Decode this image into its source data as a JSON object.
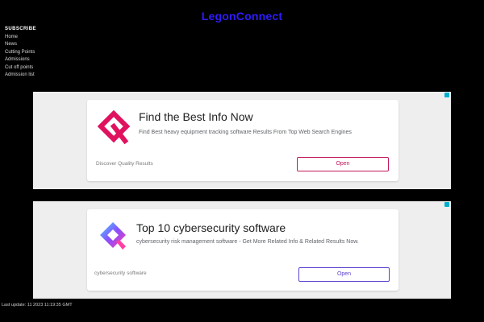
{
  "header": {
    "site_title": "LegonConnect"
  },
  "nav": {
    "items": [
      {
        "label": "SUBSCRIBE"
      },
      {
        "label": "Home"
      },
      {
        "label": "News"
      },
      {
        "label": "Cutting Points"
      },
      {
        "label": "Admissions"
      },
      {
        "label": "Cut off points"
      },
      {
        "label": "Admission list"
      }
    ]
  },
  "ads": [
    {
      "headline": "Find the Best Info Now",
      "description": "Find Best heavy equipment tracking software Results From Top Web Search Engines",
      "source": "Discover Quality Results",
      "button_label": "Open",
      "logo_icon": "red-ribbon-logo-icon",
      "accent_color": "#e0115f"
    },
    {
      "headline": "Top 10 cybersecurity software",
      "description": "cybersecurity risk management software - Get More Related Info & Related Results Now.",
      "source": "cybersecurity software",
      "button_label": "Open",
      "logo_icon": "gradient-q-logo-icon",
      "accent_color": "#5b3fd0"
    }
  ],
  "footer": {
    "text": "Last update: 11 2023 11:19:35 GMT"
  },
  "colors": {
    "title": "#2f1bff",
    "background": "#000000",
    "ad_background": "#eeeeee"
  }
}
